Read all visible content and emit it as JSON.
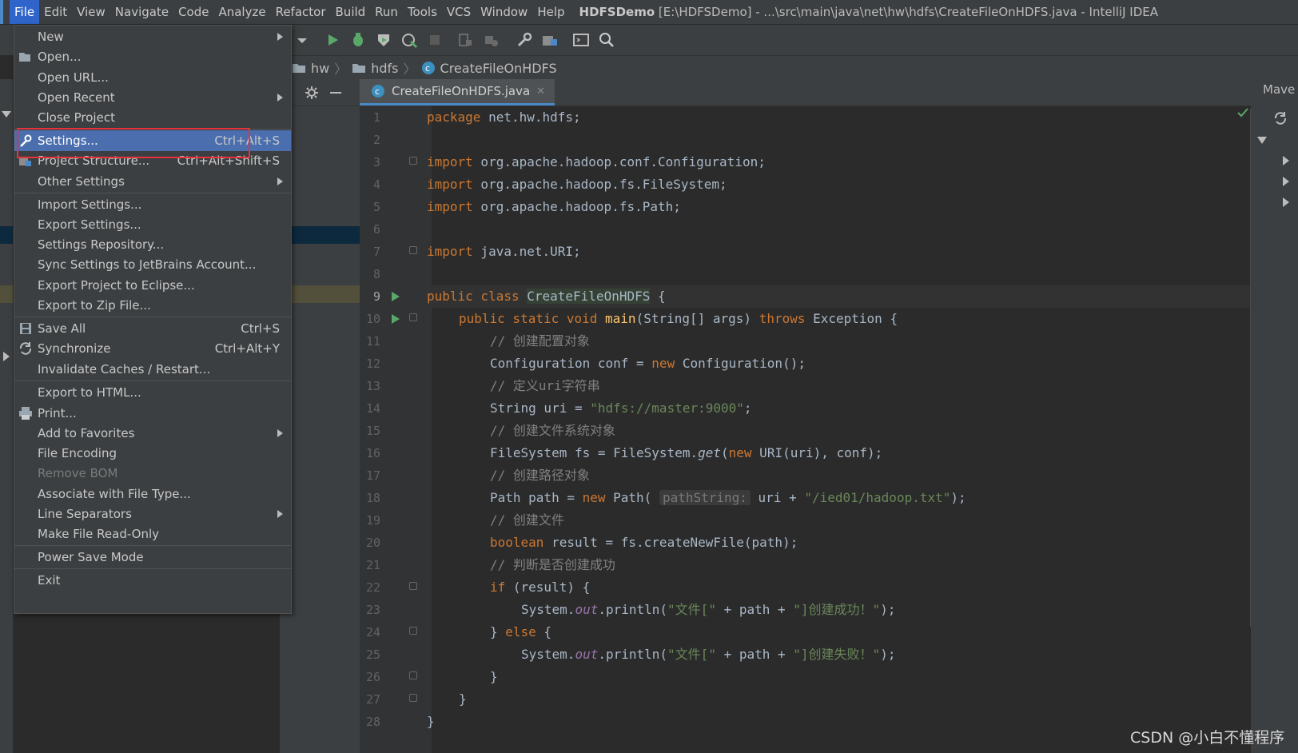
{
  "menubar": {
    "items": [
      "File",
      "Edit",
      "View",
      "Navigate",
      "Code",
      "Analyze",
      "Refactor",
      "Build",
      "Run",
      "Tools",
      "VCS",
      "Window",
      "Help"
    ],
    "window_title_bold": "HDFSDemo",
    "window_title_rest": " [E:\\HDFSDemo] - ...\\src\\main\\java\\net\\hw\\hdfs\\CreateFileOnHDFS.java - IntelliJ IDEA"
  },
  "breadcrumb": [
    "hw",
    "hdfs",
    "CreateFileOnHDFS"
  ],
  "editor_tab": {
    "label": "CreateFileOnHDFS.java"
  },
  "right_panel": {
    "label": "Mave"
  },
  "file_menu": {
    "items": [
      {
        "label": "New",
        "shortcut": "",
        "submenu": true
      },
      {
        "label": "Open...",
        "shortcut": "",
        "submenu": false
      },
      {
        "label": "Open URL...",
        "shortcut": "",
        "submenu": false
      },
      {
        "label": "Open Recent",
        "shortcut": "",
        "submenu": true
      },
      {
        "label": "Close Project",
        "shortcut": "",
        "submenu": false
      },
      {
        "label": "Settings...",
        "shortcut": "Ctrl+Alt+S",
        "submenu": false
      },
      {
        "label": "Project Structure...",
        "shortcut": "Ctrl+Alt+Shift+S",
        "submenu": false
      },
      {
        "label": "Other Settings",
        "shortcut": "",
        "submenu": true
      },
      {
        "label": "Import Settings...",
        "shortcut": "",
        "submenu": false
      },
      {
        "label": "Export Settings...",
        "shortcut": "",
        "submenu": false
      },
      {
        "label": "Settings Repository...",
        "shortcut": "",
        "submenu": false
      },
      {
        "label": "Sync Settings to JetBrains Account...",
        "shortcut": "",
        "submenu": false
      },
      {
        "label": "Export Project to Eclipse...",
        "shortcut": "",
        "submenu": false
      },
      {
        "label": "Export to Zip File...",
        "shortcut": "",
        "submenu": false
      },
      {
        "label": "Save All",
        "shortcut": "Ctrl+S",
        "submenu": false
      },
      {
        "label": "Synchronize",
        "shortcut": "Ctrl+Alt+Y",
        "submenu": false
      },
      {
        "label": "Invalidate Caches / Restart...",
        "shortcut": "",
        "submenu": false
      },
      {
        "label": "Export to HTML...",
        "shortcut": "",
        "submenu": false
      },
      {
        "label": "Print...",
        "shortcut": "",
        "submenu": false
      },
      {
        "label": "Add to Favorites",
        "shortcut": "",
        "submenu": true
      },
      {
        "label": "File Encoding",
        "shortcut": "",
        "submenu": false
      },
      {
        "label": "Remove BOM",
        "shortcut": "",
        "submenu": false
      },
      {
        "label": "Associate with File Type...",
        "shortcut": "",
        "submenu": false
      },
      {
        "label": "Line Separators",
        "shortcut": "",
        "submenu": true
      },
      {
        "label": "Make File Read-Only",
        "shortcut": "",
        "submenu": false
      },
      {
        "label": "Power Save Mode",
        "shortcut": "",
        "submenu": false
      },
      {
        "label": "Exit",
        "shortcut": "",
        "submenu": false
      }
    ]
  },
  "code": {
    "line_numbers": [
      "1",
      "2",
      "3",
      "4",
      "5",
      "6",
      "7",
      "8",
      "9",
      "10",
      "11",
      "12",
      "13",
      "14",
      "15",
      "16",
      "17",
      "18",
      "19",
      "20",
      "21",
      "22",
      "23",
      "24",
      "25",
      "26",
      "27",
      "28"
    ],
    "l1_kw": "package",
    "l1_rest": " net.hw.hdfs;",
    "l3_kw": "import",
    "l3_rest": " org.apache.hadoop.conf.Configuration;",
    "l4_kw": "import",
    "l4_rest": " org.apache.hadoop.fs.FileSystem;",
    "l5_kw": "import",
    "l5_rest": " org.apache.hadoop.fs.Path;",
    "l7_kw": "import",
    "l7_rest": " java.net.URI;",
    "l9_kw": "public class ",
    "l9_cls": "CreateFileOnHDFS",
    "l9_rest": " {",
    "l10_kw": "public static void ",
    "l10_fn": "main",
    "l10_mid": "(String[] args) ",
    "l10_kw2": "throws",
    "l10_rest": " Exception {",
    "l11": "// 创建配置对象",
    "l12_a": "Configuration conf = ",
    "l12_kw": "new",
    "l12_b": " Configuration();",
    "l13": "// 定义uri字符串",
    "l14_a": "String uri = ",
    "l14_str": "\"hdfs://master:9000\"",
    "l14_b": ";",
    "l15": "// 创建文件系统对象",
    "l16_a": "FileSystem fs = FileSystem.",
    "l16_it": "get",
    "l16_b": "(",
    "l16_kw": "new",
    "l16_c": " URI(uri), conf);",
    "l17": "// 创建路径对象",
    "l18_a": "Path path = ",
    "l18_kw": "new",
    "l18_b": " Path( ",
    "l18_hint": "pathString:",
    "l18_c": " uri + ",
    "l18_str": "\"/ied01/hadoop.txt\"",
    "l18_d": ");",
    "l19": "// 创建文件",
    "l20_kw": "boolean",
    "l20_rest": " result = fs.createNewFile(path);",
    "l21": "// 判断是否创建成功",
    "l22_kw": "if",
    "l22_rest": " (result) {",
    "l23_a": "System.",
    "l23_st": "out",
    "l23_b": ".println(",
    "l23_str1": "\"文件[\"",
    "l23_c": " + path + ",
    "l23_str2": "\"]创建成功！\"",
    "l23_d": ");",
    "l24_a": "} ",
    "l24_kw": "else",
    "l24_b": " {",
    "l25_a": "System.",
    "l25_st": "out",
    "l25_b": ".println(",
    "l25_str1": "\"文件[\"",
    "l25_c": " + path + ",
    "l25_str2": "\"]创建失败！\"",
    "l25_d": ");",
    "l26": "}",
    "l27": "}",
    "l28": "}"
  },
  "watermark": "CSDN @小白不懂程序",
  "colors": {
    "accent": "#4b6eaf",
    "highlight_box": "#e4333d",
    "keyword": "#cc7832",
    "string": "#6a8759",
    "comment": "#808080"
  },
  "icons": [
    "folder-icon",
    "run-icon",
    "debug-icon",
    "coverage-icon",
    "profile-icon",
    "stop-icon",
    "build-icon",
    "wrench-icon",
    "project-structure-icon",
    "terminal-icon",
    "search-icon",
    "gear-icon",
    "collapse-icon",
    "class-icon",
    "refresh-icon",
    "check-icon"
  ]
}
